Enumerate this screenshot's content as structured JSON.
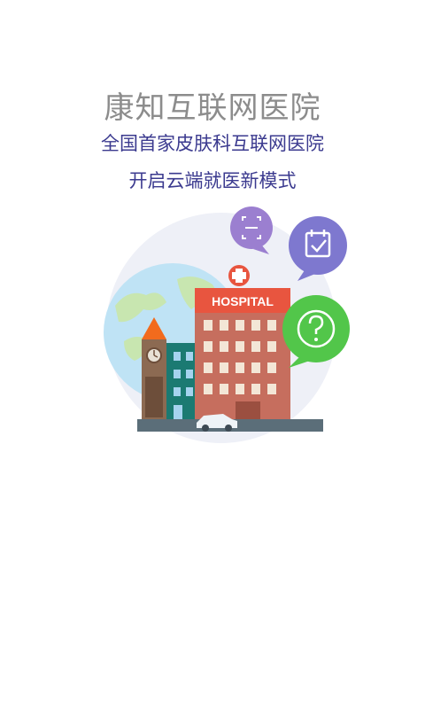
{
  "app_title": "康知互联网医院",
  "tagline_line1": "全国首家皮肤科互联网医院",
  "tagline_line2": "开启云端就医新模式",
  "illustration": {
    "hospital_sign": "HOSPITAL",
    "icons": [
      "scan-icon",
      "calendar-check-icon",
      "help-question-icon",
      "medical-cross-icon"
    ],
    "colors": {
      "title_gray": "#8c8c8c",
      "tagline_indigo": "#3b3a8f",
      "scan_bubble": "#9b7fd0",
      "calendar_bubble": "#7e78cf",
      "help_bubble": "#52c64a",
      "hospital_sign": "#e8553f",
      "hospital_body": "#c66e5e"
    }
  }
}
